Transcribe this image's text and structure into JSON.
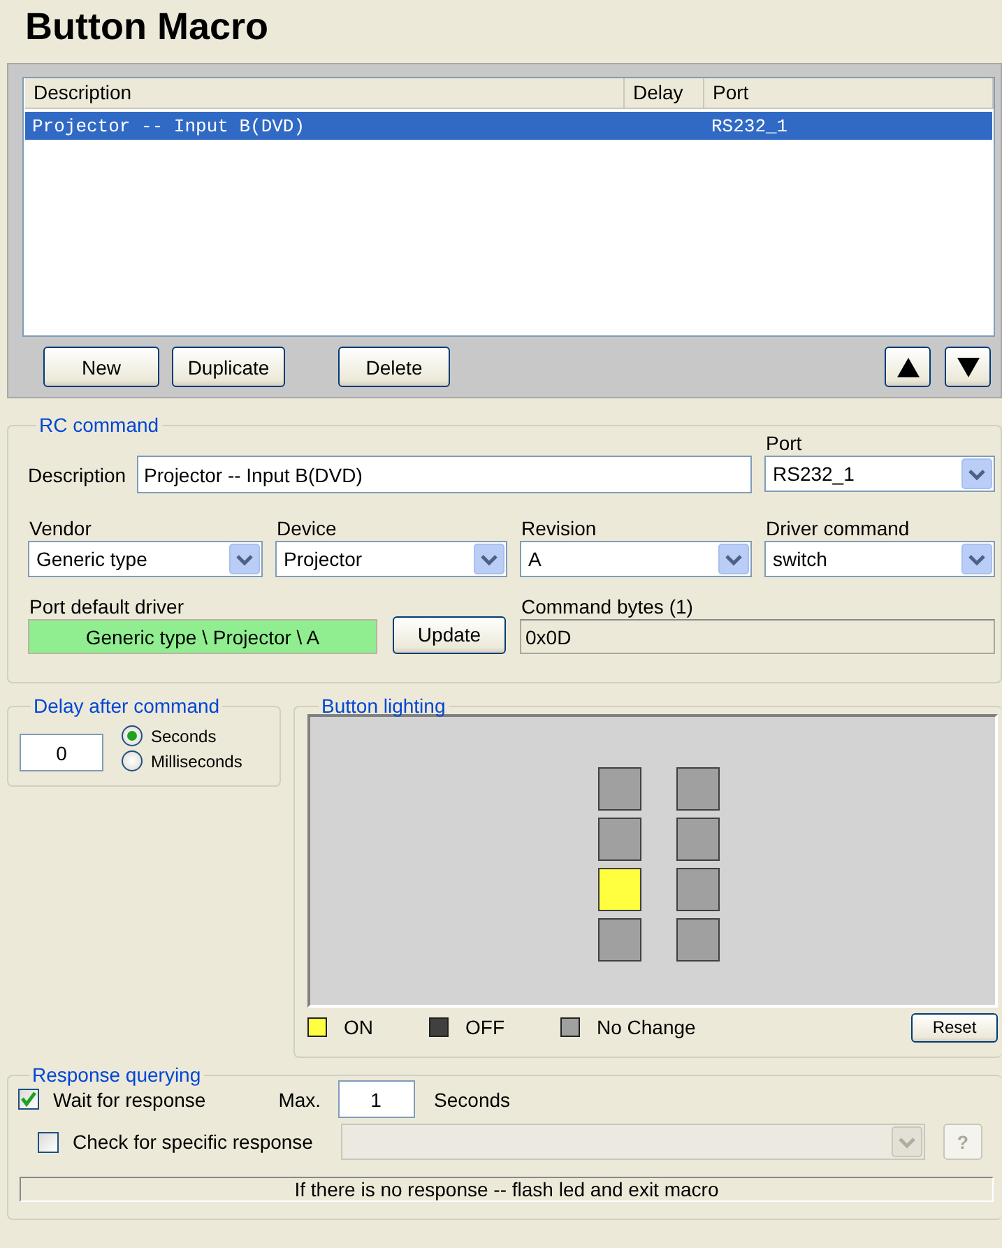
{
  "title": "Button Macro",
  "macro_list": {
    "columns": [
      "Description",
      "Delay",
      "Port"
    ],
    "rows": [
      {
        "description": "Projector -- Input B(DVD)",
        "port": "RS232_1",
        "selected": true
      }
    ],
    "buttons": [
      "New",
      "Duplicate",
      "Delete"
    ]
  },
  "rc_command": {
    "title": "RC command",
    "description": {
      "label": "Description",
      "value": "Projector -- Input B(DVD)"
    },
    "port": {
      "label": "Port",
      "value": "RS232_1"
    },
    "dropdowns": [
      {
        "label": "Vendor",
        "value": "Generic type"
      },
      {
        "label": "Device",
        "value": "Projector"
      },
      {
        "label": "Revision",
        "value": "A"
      },
      {
        "label": "Driver command",
        "value": "switch"
      }
    ],
    "default_driver": {
      "label": "Port default driver",
      "value": "Generic type \\ Projector \\ A"
    },
    "update_button": "Update",
    "command_bytes": {
      "label": "Command bytes (1)",
      "value": "0x0D"
    }
  },
  "delay": {
    "title": "Delay after command",
    "value": "0",
    "units": [
      {
        "label": "Seconds",
        "selected": true
      },
      {
        "label": "Milliseconds",
        "selected": false
      }
    ]
  },
  "lighting": {
    "title": "Button lighting",
    "columns": [
      {
        "leds": [
          {
            "color": "#a0a0a0"
          },
          {
            "color": "#a0a0a0"
          },
          {
            "color": "#ffff40"
          },
          {
            "color": "#a0a0a0"
          }
        ]
      },
      {
        "leds": [
          {
            "color": "#a0a0a0"
          },
          {
            "color": "#a0a0a0"
          },
          {
            "color": "#a0a0a0"
          },
          {
            "color": "#a0a0a0"
          }
        ]
      }
    ],
    "legend": [
      {
        "color": "#ffff40",
        "label": "ON"
      },
      {
        "color": "#404040",
        "label": "OFF"
      },
      {
        "color": "#a0a0a0",
        "label": "No Change"
      }
    ],
    "reset_button": "Reset"
  },
  "response": {
    "title": "Response querying",
    "wait": {
      "label": "Wait for response",
      "checked": true
    },
    "max_label": "Max.",
    "max_value": "1",
    "unit": "Seconds",
    "specific": {
      "label": "Check for specific response",
      "checked": false
    },
    "specific_dropdown": {
      "disabled": true
    },
    "help_button": {
      "label": "?",
      "disabled": true
    },
    "message": "If there is no response -- flash led and exit macro"
  }
}
